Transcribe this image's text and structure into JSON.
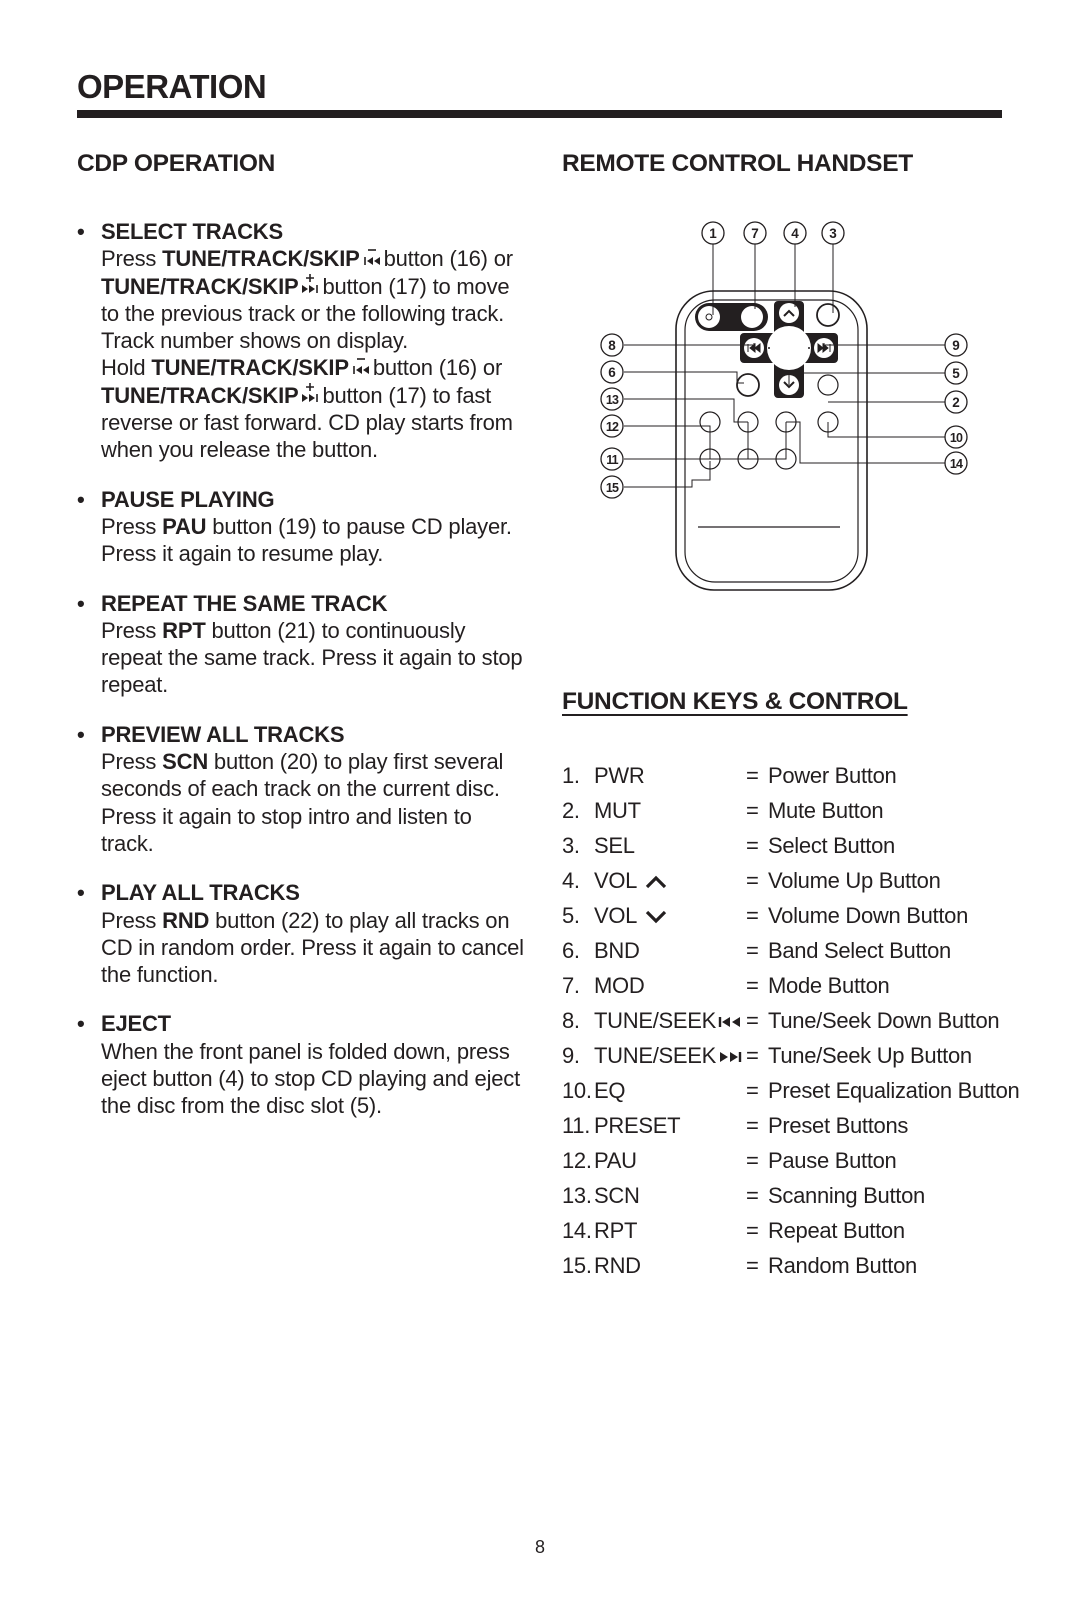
{
  "page": {
    "title": "OPERATION",
    "page_number": "8"
  },
  "cdp_operation": {
    "title": "CDP OPERATION",
    "items": [
      {
        "heading": "SELECT TRACKS",
        "paragraphs": [
          [
            {
              "t": "Press "
            },
            {
              "t": "TUNE/TRACK/SKIP",
              "b": true
            },
            {
              "icon": "skip-back-minus-icon"
            },
            {
              "t": "button (16) or "
            },
            {
              "t": "TUNE/TRACK/SKIP",
              "b": true
            },
            {
              "icon": "skip-forward-plus-icon"
            },
            {
              "t": "button (17) to move to the previous track or the following track.  Track number shows on display."
            }
          ],
          [
            {
              "t": "Hold "
            },
            {
              "t": "TUNE/TRACK/SKIP",
              "b": true
            },
            {
              "icon": "skip-back-minus-icon"
            },
            {
              "t": "button (16) or "
            },
            {
              "t": "TUNE/TRACK/SKIP",
              "b": true
            },
            {
              "icon": "skip-forward-plus-icon"
            },
            {
              "t": "button (17) to fast reverse or fast forward.  CD play starts from when you release the button."
            }
          ]
        ]
      },
      {
        "heading": "PAUSE PLAYING",
        "paragraphs": [
          [
            {
              "t": "Press "
            },
            {
              "t": "PAU",
              "b": true
            },
            {
              "t": " button (19) to pause CD player.  Press it again to resume play."
            }
          ]
        ]
      },
      {
        "heading": "REPEAT THE SAME TRACK",
        "paragraphs": [
          [
            {
              "t": "Press "
            },
            {
              "t": "RPT",
              "b": true
            },
            {
              "t": " button (21) to continuously repeat the same track.  Press it again to stop repeat."
            }
          ]
        ]
      },
      {
        "heading": "PREVIEW ALL TRACKS",
        "paragraphs": [
          [
            {
              "t": "Press "
            },
            {
              "t": "SCN",
              "b": true
            },
            {
              "t": " button (20) to play first several seconds of each track on the current disc."
            }
          ],
          [
            {
              "t": "Press it again to stop intro and listen to track."
            }
          ]
        ]
      },
      {
        "heading": "PLAY ALL TRACKS",
        "paragraphs": [
          [
            {
              "t": "Press "
            },
            {
              "t": "RND",
              "b": true
            },
            {
              "t": " button (22) to play all tracks on CD in random order.  Press it again to cancel the function."
            }
          ]
        ]
      },
      {
        "heading": "EJECT",
        "paragraphs": [
          [
            {
              "t": "When the front panel is folded down, press eject button (4) to stop CD playing and eject the disc from the disc slot (5)."
            }
          ]
        ]
      }
    ]
  },
  "remote_control": {
    "title": "REMOTE CONTROL HANDSET",
    "callouts": [
      "1",
      "7",
      "4",
      "3",
      "8",
      "6",
      "13",
      "12",
      "11",
      "15",
      "9",
      "5",
      "2",
      "10",
      "14"
    ]
  },
  "function_keys": {
    "title": "FUNCTION KEYS & CONTROL",
    "rows": [
      {
        "num": "1.",
        "code": "PWR",
        "icon": null,
        "eq": "=",
        "desc": "Power Button"
      },
      {
        "num": "2.",
        "code": "MUT",
        "icon": null,
        "eq": "=",
        "desc": "Mute Button"
      },
      {
        "num": "3.",
        "code": "SEL",
        "icon": null,
        "eq": "=",
        "desc": "Select Button"
      },
      {
        "num": "4.",
        "code": "VOL",
        "icon": "chevron-up-icon",
        "eq": "=",
        "desc": "Volume Up Button"
      },
      {
        "num": "5.",
        "code": "VOL",
        "icon": "chevron-down-icon",
        "eq": "=",
        "desc": "Volume Down Button"
      },
      {
        "num": "6.",
        "code": "BND",
        "icon": null,
        "eq": "=",
        "desc": "Band Select Button"
      },
      {
        "num": "7.",
        "code": "MOD",
        "icon": null,
        "eq": "=",
        "desc": "Mode Button"
      },
      {
        "num": "8.",
        "code": "TUNE/SEEK",
        "icon": "skip-back-icon",
        "eq": "=",
        "desc": "Tune/Seek Down Button"
      },
      {
        "num": "9.",
        "code": "TUNE/SEEK",
        "icon": "skip-forward-icon",
        "eq": "=",
        "desc": "Tune/Seek Up Button"
      },
      {
        "num": "10.",
        "code": "EQ",
        "icon": null,
        "eq": "=",
        "desc": "Preset Equalization Button"
      },
      {
        "num": "11.",
        "code": "PRESET",
        "icon": null,
        "eq": "=",
        "desc": "Preset Buttons"
      },
      {
        "num": "12.",
        "code": "PAU",
        "icon": null,
        "eq": "=",
        "desc": "Pause Button"
      },
      {
        "num": "13.",
        "code": "SCN",
        "icon": null,
        "eq": "=",
        "desc": "Scanning Button"
      },
      {
        "num": "14.",
        "code": "RPT",
        "icon": null,
        "eq": "=",
        "desc": "Repeat Button"
      },
      {
        "num": "15.",
        "code": "RND",
        "icon": null,
        "eq": "=",
        "desc": "Random Button"
      }
    ]
  }
}
